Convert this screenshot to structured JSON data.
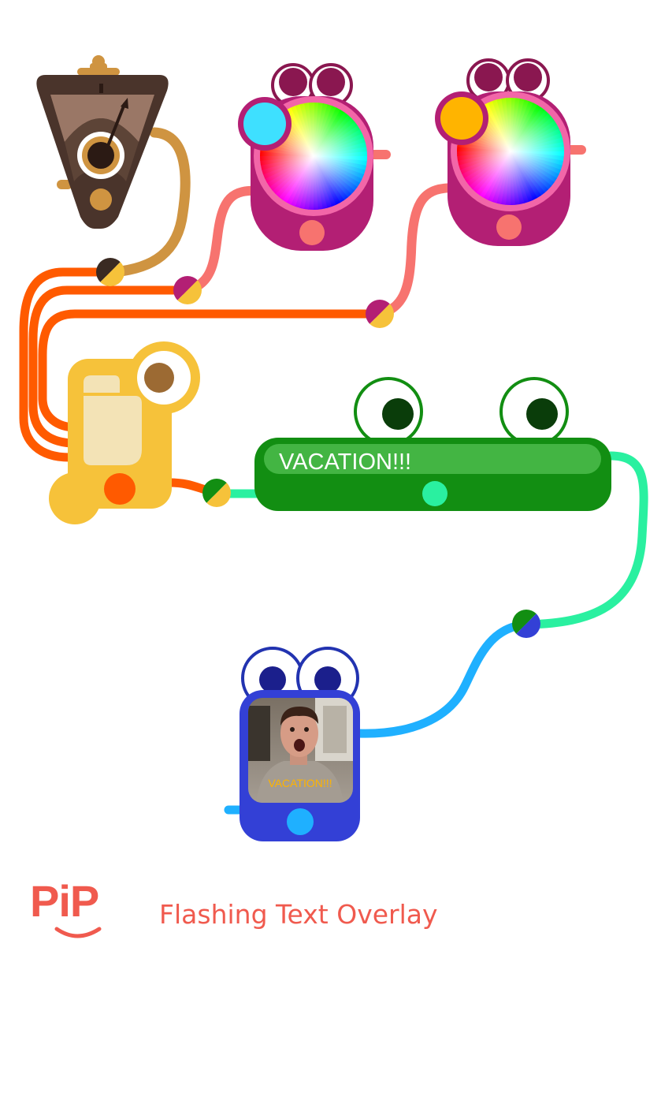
{
  "app": {
    "logo_text": "PiP",
    "caption": "Flashing Text Overlay"
  },
  "nodes": {
    "metronome": {
      "icon": "metronome-icon",
      "color": "#4a342b"
    },
    "color_picker_1": {
      "icon": "color-wheel-icon",
      "swatch": "#3ee0ff",
      "color": "#b31f74"
    },
    "color_picker_2": {
      "icon": "color-wheel-icon",
      "swatch": "#ffb400",
      "color": "#b31f74"
    },
    "text_source": {
      "icon": "text-node-icon",
      "color": "#f6c23a"
    },
    "text_display": {
      "text": "VACATION!!!",
      "color": "#128e12"
    },
    "video_output": {
      "overlay_text": "VACATION!!!",
      "color": "#3340d6"
    }
  },
  "cables": {
    "brown": "#cf9441",
    "orange": "#ff5a00",
    "pink": "#f7736f",
    "mint": "#2af0a0",
    "blue": "#1fb0ff"
  }
}
